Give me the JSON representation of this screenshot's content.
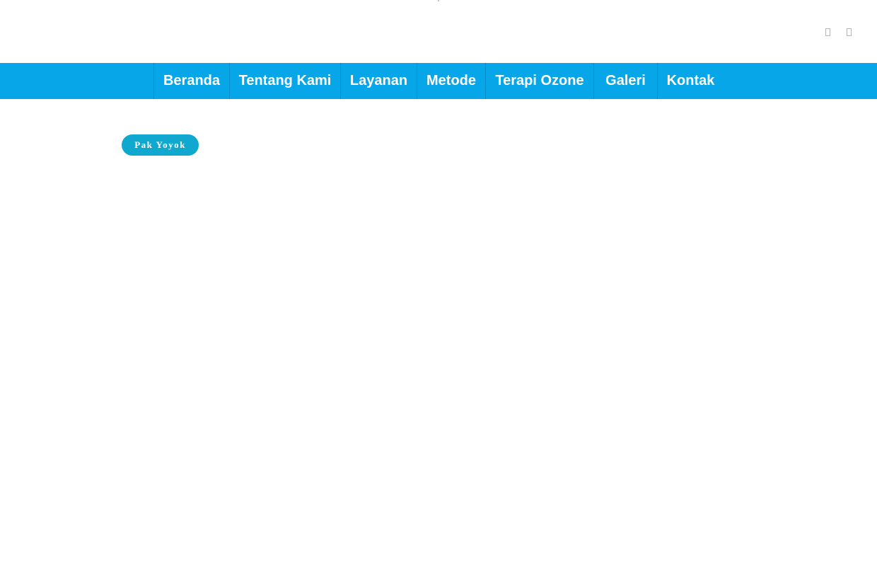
{
  "header": {
    "icons": [
      "unknown-glyph-icon",
      "unknown-glyph-icon"
    ]
  },
  "nav": {
    "items": [
      {
        "label": "Beranda"
      },
      {
        "label": "Tentang Kami"
      },
      {
        "label": "Layanan"
      },
      {
        "label": "Metode"
      },
      {
        "label": "Terapi Ozone"
      },
      {
        "label": "Galeri"
      },
      {
        "label": "Kontak"
      }
    ],
    "background_color": "#06a6e8",
    "text_color": "#ffffff"
  },
  "content": {
    "tag_label": "Pak Yoyok",
    "tag_color": "#11a8cf"
  }
}
